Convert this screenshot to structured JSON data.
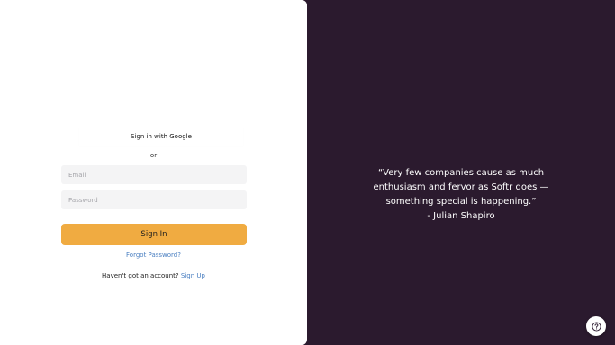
{
  "auth": {
    "google_label": "Sign in with Google",
    "divider_text": "or",
    "email_placeholder": "Email",
    "password_placeholder": "Password",
    "signin_label": "Sign In",
    "forgot_label": "Forgot Password?",
    "no_account_text": "Haven't got an account?",
    "signup_label": "Sign Up"
  },
  "testimonial": {
    "quote": "“Very few companies cause as much enthusiasm and fervor as Softr does — something special is happening.”",
    "author": "- Julian Shapiro"
  },
  "help": {
    "icon": "question-circle-icon"
  },
  "colors": {
    "left_background": "#ffffff",
    "right_background": "#2b1a2e",
    "primary_button": "#f0ab41",
    "link": "#4a7fc1",
    "input_background": "#f4f4f5"
  }
}
